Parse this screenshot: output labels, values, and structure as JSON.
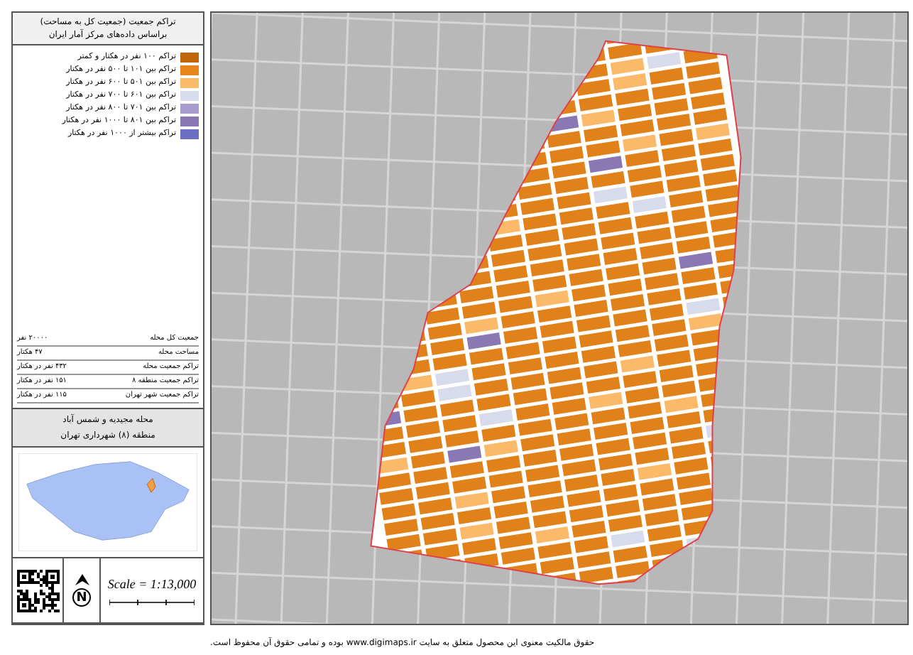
{
  "legend": {
    "title_lines": [
      "تراکم جمعیت (جمعیت کل به مساحت)",
      "براساس داده‌های مرکز آمار ایران"
    ],
    "items": [
      {
        "label": "تراکم ۱۰۰ نفر در هکتار و کمتر",
        "color": "#c0650a"
      },
      {
        "label": "تراکم بین ۱۰۱ تا ۵۰۰ نفر در هکتار",
        "color": "#e8851a"
      },
      {
        "label": "تراکم بین ۵۰۱ تا ۶۰۰ نفر در هکتار",
        "color": "#fbb96a"
      },
      {
        "label": "تراکم بین ۶۰۱ تا ۷۰۰ نفر در هکتار",
        "color": "#d8dbec"
      },
      {
        "label": "تراکم بین ۷۰۱ تا ۸۰۰ نفر در هکتار",
        "color": "#a79ccc"
      },
      {
        "label": "تراکم بین ۸۰۱ تا ۱۰۰۰ نفر در هکتار",
        "color": "#8a78b5"
      },
      {
        "label": "تراکم بیشتر از ۱۰۰۰ نفر در هکتار",
        "color": "#6a6fc4"
      }
    ]
  },
  "stats": [
    {
      "label": "جمعیت کل محله",
      "value": "۲۰۰۰۰ نفر"
    },
    {
      "label": "مساحت محله",
      "value": "۴۷ هکتار"
    },
    {
      "label": "تراکم جمعیت محله",
      "value": "۴۳۲ نفر در هکتار"
    },
    {
      "label": "تراکم جمعیت منطقه ۸",
      "value": "۱۵۱ نفر در هکتار"
    },
    {
      "label": "تراکم جمعیت شهر تهران",
      "value": "۱۱۵ نفر در هکتار"
    }
  ],
  "area": [
    "محله مجیدیه و شمس آباد",
    "منطقه (۸) شهرداری تهران"
  ],
  "north_label": "N",
  "scale": "Scale = 1:13,000",
  "footer": "حقوق مالکیت معنوی این محصول متعلق به سایت www.digimaps.ir بوده و تمامی حقوق آن محفوظ است."
}
